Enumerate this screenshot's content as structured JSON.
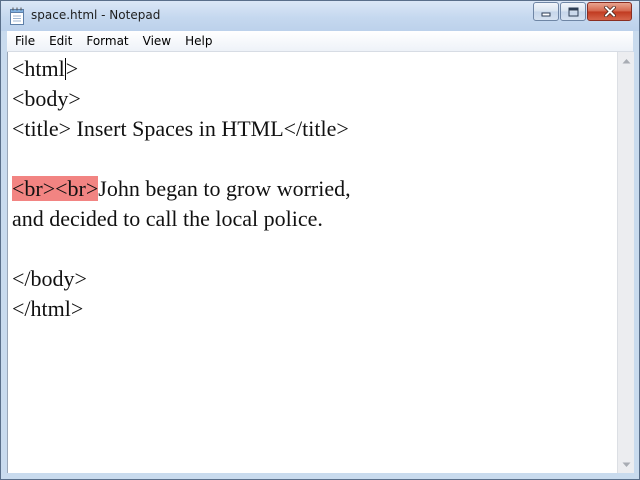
{
  "window": {
    "title": "space.html - Notepad",
    "app_icon": "notepad-icon",
    "controls": [
      "minimize-icon",
      "maximize-icon",
      "close-icon"
    ]
  },
  "menu": {
    "items": [
      "File",
      "Edit",
      "Format",
      "View",
      "Help"
    ]
  },
  "editor": {
    "lines": [
      "<html>",
      "<body>",
      "<title> Insert Spaces in HTML</title>",
      "",
      "<br><br>John began to grow worried,",
      "and decided to call the local police.",
      "",
      "</body>",
      "</html>"
    ],
    "line0_before_caret": "<html",
    "line0_after_caret": ">",
    "line4_highlighted": "<br><br>",
    "line4_rest": "John began to grow worried,",
    "highlight_color": "#f28482"
  }
}
